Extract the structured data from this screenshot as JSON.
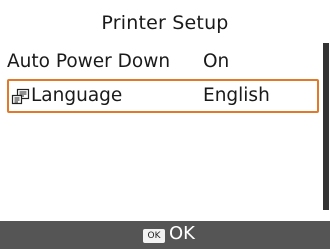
{
  "title": "Printer Setup",
  "settings": [
    {
      "label": "Auto Power Down",
      "value": "On"
    },
    {
      "label": "Language",
      "value": "English",
      "icon": "language-icon",
      "selected": true
    }
  ],
  "footer": {
    "key": "OK",
    "action": "OK"
  },
  "colors": {
    "highlight": "#e07a2a",
    "footer_bg": "#555555",
    "scrollbar": "#333333"
  }
}
